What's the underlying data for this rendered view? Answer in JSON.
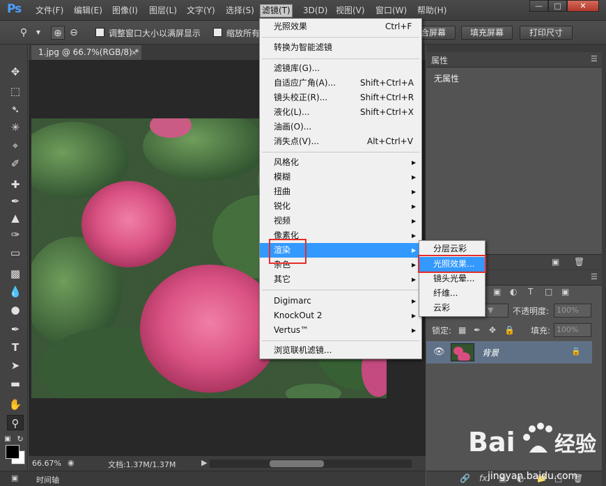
{
  "app": {
    "logo": "Ps"
  },
  "menubar": {
    "items": [
      {
        "label": "文件(F)"
      },
      {
        "label": "编辑(E)"
      },
      {
        "label": "图像(I)"
      },
      {
        "label": "图层(L)"
      },
      {
        "label": "文字(Y)"
      },
      {
        "label": "选择(S)"
      },
      {
        "label": "滤镜(T)"
      },
      {
        "label": "3D(D)"
      },
      {
        "label": "视图(V)"
      },
      {
        "label": "窗口(W)"
      },
      {
        "label": "帮助(H)"
      }
    ],
    "window_controls": {
      "minimize": "—",
      "maximize": "□",
      "close": "✕"
    }
  },
  "options_bar": {
    "resize_windows_label": "调整窗口大小以满屏显示",
    "zoom_all_label": "缩放所有",
    "fit_screen_label": "合屏幕",
    "fill_screen_label": "填充屏幕",
    "print_size_label": "打印尺寸"
  },
  "document": {
    "tab_title": "1.jpg @ 66.7%(RGB/8) *",
    "tab_close": "×",
    "zoom": "66.67%",
    "doc_info": "文档:1.37M/1.37M",
    "timeline_label": "时间轴"
  },
  "filter_menu": {
    "items": [
      {
        "label": "光照效果",
        "shortcut": "Ctrl+F"
      },
      {
        "label": "转换为智能滤镜"
      },
      {
        "label": "滤镜库(G)..."
      },
      {
        "label": "自适应广角(A)...",
        "shortcut": "Shift+Ctrl+A"
      },
      {
        "label": "镜头校正(R)...",
        "shortcut": "Shift+Ctrl+R"
      },
      {
        "label": "液化(L)...",
        "shortcut": "Shift+Ctrl+X"
      },
      {
        "label": "油画(O)..."
      },
      {
        "label": "消失点(V)...",
        "shortcut": "Alt+Ctrl+V"
      },
      {
        "label": "风格化",
        "submenu": true
      },
      {
        "label": "模糊",
        "submenu": true
      },
      {
        "label": "扭曲",
        "submenu": true
      },
      {
        "label": "锐化",
        "submenu": true
      },
      {
        "label": "视频",
        "submenu": true
      },
      {
        "label": "像素化",
        "submenu": true
      },
      {
        "label": "渲染",
        "submenu": true,
        "highlighted": true
      },
      {
        "label": "杂色",
        "submenu": true
      },
      {
        "label": "其它",
        "submenu": true
      },
      {
        "label": "Digimarc",
        "submenu": true
      },
      {
        "label": "KnockOut 2",
        "submenu": true
      },
      {
        "label": "Vertus™",
        "submenu": true
      },
      {
        "label": "浏览联机滤镜..."
      }
    ]
  },
  "render_submenu": {
    "items": [
      {
        "label": "分层云彩"
      },
      {
        "label": "光照效果...",
        "highlighted": true
      },
      {
        "label": "镜头光晕..."
      },
      {
        "label": "纤维..."
      },
      {
        "label": "云彩"
      }
    ]
  },
  "properties_panel": {
    "tab": "属性",
    "empty_text": "无属性"
  },
  "layers_panel": {
    "opacity_label": "不透明度:",
    "opacity_value": "100%",
    "lock_label": "锁定:",
    "fill_label": "填充:",
    "fill_value": "100%",
    "layer_name": "背景"
  },
  "watermark": {
    "url": "jingyan.baidu.com"
  },
  "colors": {
    "menu_highlight": "#3399ff",
    "annotation_red": "#e52b2b",
    "layer_selected": "#5f7187"
  }
}
